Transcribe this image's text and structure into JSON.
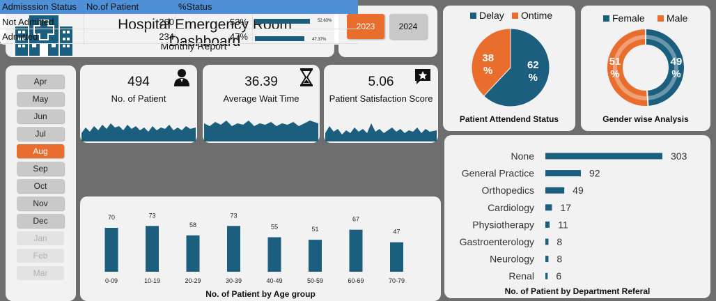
{
  "header": {
    "title": "Hospital Emergency Room Dashboard",
    "subtitle": "Monthly Report"
  },
  "years": [
    {
      "label": "2023",
      "active": true
    },
    {
      "label": "2024",
      "active": false
    }
  ],
  "months": [
    {
      "label": "Apr",
      "state": "normal"
    },
    {
      "label": "May",
      "state": "normal"
    },
    {
      "label": "Jun",
      "state": "normal"
    },
    {
      "label": "Jul",
      "state": "normal"
    },
    {
      "label": "Aug",
      "state": "selected"
    },
    {
      "label": "Sep",
      "state": "normal"
    },
    {
      "label": "Oct",
      "state": "normal"
    },
    {
      "label": "Nov",
      "state": "normal"
    },
    {
      "label": "Dec",
      "state": "normal"
    },
    {
      "label": "Jan",
      "state": "disabled"
    },
    {
      "label": "Feb",
      "state": "disabled"
    },
    {
      "label": "Mar",
      "state": "disabled"
    }
  ],
  "kpis": [
    {
      "value": "494",
      "label": "No. of Patient",
      "icon": "person-icon"
    },
    {
      "value": "36.39",
      "label": "Average Wait Time",
      "icon": "hourglass-icon"
    },
    {
      "value": "5.06",
      "label": "Patient Satisfaction Score",
      "icon": "star-chat-icon"
    }
  ],
  "admission_table": {
    "headers": [
      "Admisssion Status",
      "No.of  Patient",
      "%Status"
    ],
    "rows": [
      {
        "status": "Not Admitted",
        "patients": "260",
        "percent": "53%",
        "bar_label": "52.63%",
        "fraction": 0.5263
      },
      {
        "status": "Admitted",
        "patients": "234",
        "percent": "47%",
        "bar_label": "47.37%",
        "fraction": 0.4737
      }
    ]
  },
  "colors": {
    "accent": "#e96e2e",
    "primary": "#1b5e7e",
    "header_blue": "#4f8fd6"
  },
  "chart_data": [
    {
      "type": "pie",
      "title": "Patient Attendend Status",
      "legend": [
        "Delay",
        "Ontime"
      ],
      "values": [
        62,
        38
      ],
      "labels": [
        "62 %",
        "38 %"
      ],
      "colors": [
        "#1b5e7e",
        "#e96e2e"
      ]
    },
    {
      "type": "pie",
      "title": "Gender wise Analysis",
      "legend": [
        "Female",
        "Male"
      ],
      "values": [
        49,
        51
      ],
      "labels": [
        "49 %",
        "51 %"
      ],
      "colors": [
        "#1b5e7e",
        "#e96e2e"
      ]
    },
    {
      "type": "bar",
      "title": "No. of Patient by Age group",
      "categories": [
        "0-09",
        "10-19",
        "20-29",
        "30-39",
        "40-49",
        "50-59",
        "60-69",
        "70-79"
      ],
      "values": [
        70,
        73,
        58,
        73,
        55,
        51,
        67,
        47
      ]
    },
    {
      "type": "bar",
      "orientation": "horizontal",
      "title": "No. of Patient by Department Referal",
      "categories": [
        "None",
        "General Practice",
        "Orthopedics",
        "Cardiology",
        "Physiotherapy",
        "Gastroenterology",
        "Neurology",
        "Renal"
      ],
      "values": [
        303,
        92,
        49,
        17,
        11,
        8,
        8,
        6
      ]
    }
  ]
}
